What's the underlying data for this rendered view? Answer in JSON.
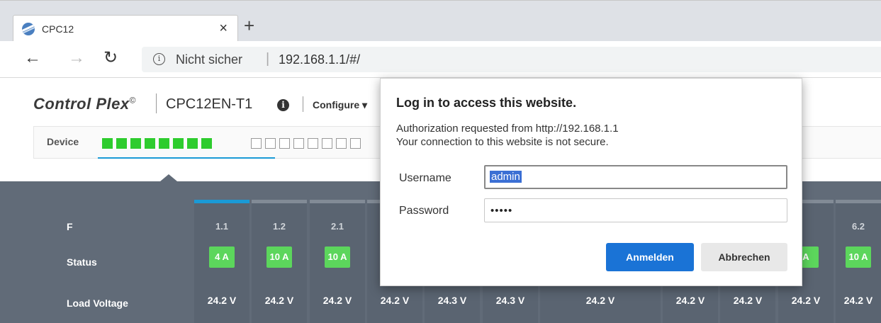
{
  "browser": {
    "tab_title": "CPC12",
    "tab_close": "×",
    "new_tab": "+",
    "back": "←",
    "forward": "→",
    "reload": "↻",
    "security_text": "Nicht sicher",
    "url": "192.168.1.1/#/"
  },
  "app": {
    "brand": "Control Plex",
    "brand_mark": "©",
    "model": "CPC12EN-T1",
    "model_info_glyph": "i",
    "menu_configure": "Configure ▾",
    "device_label": "Device",
    "filled_squares": 8,
    "empty_squares": 8
  },
  "panel": {
    "row_labels": {
      "f": "F",
      "status": "Status",
      "load_voltage": "Load Voltage"
    },
    "channels": [
      {
        "f": "1.1",
        "status": "4 A",
        "voltage": "24.2 V",
        "active": true
      },
      {
        "f": "1.2",
        "status": "10 A",
        "voltage": "24.2 V"
      },
      {
        "f": "2.1",
        "status": "10 A",
        "voltage": "24.2 V"
      },
      {
        "f": "",
        "status": "",
        "voltage": "24.2 V"
      },
      {
        "f": "",
        "status": "",
        "voltage": "24.3 V"
      },
      {
        "f": "",
        "status": "",
        "voltage": "24.3 V"
      },
      {
        "f": "",
        "status": "",
        "voltage": "24.2 V"
      },
      {
        "f": "",
        "status": "",
        "voltage": "24.2 V"
      },
      {
        "f": "",
        "status": "",
        "voltage": "24.2 V"
      },
      {
        "f": "",
        "status": "A",
        "voltage": "24.2 V"
      },
      {
        "f": "6.2",
        "status": "10 A",
        "voltage": "24.2 V"
      }
    ],
    "colors": {
      "panel_bg": "#616b78",
      "status_green": "#5cd65c",
      "active_tab": "#1a9ad6"
    }
  },
  "dialog": {
    "title": "Log in to access this website.",
    "message_line1": "Authorization requested from http://192.168.1.1",
    "message_line2": "Your connection to this website is not secure.",
    "username_label": "Username",
    "username_value": "admin",
    "password_label": "Password",
    "password_value": "•••••",
    "submit_label": "Anmelden",
    "cancel_label": "Abbrechen",
    "colors": {
      "primary_button": "#1a73d6"
    }
  }
}
